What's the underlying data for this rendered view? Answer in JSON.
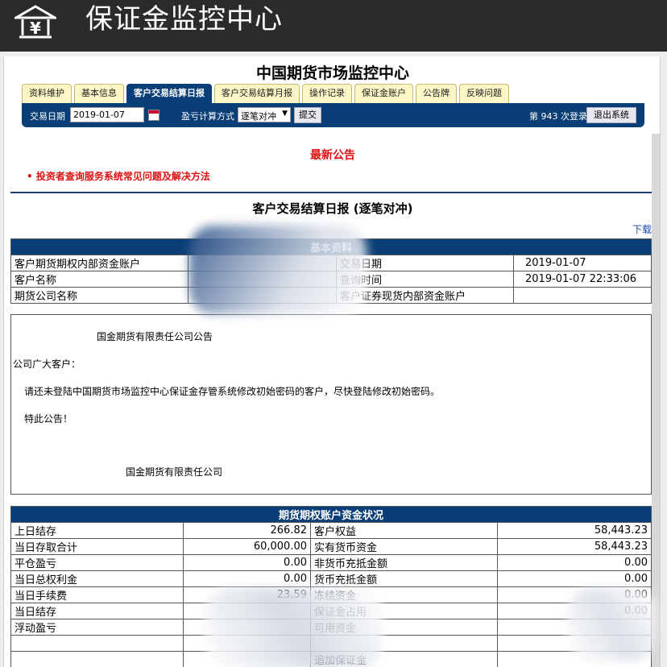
{
  "app": {
    "title": "保证金监控中心",
    "logo_icon": "bank-yen-icon"
  },
  "page": {
    "heading": "中国期货市场监控中心",
    "tabs": [
      "资料维护",
      "基本信息",
      "客户交易结算日报",
      "客户交易结算月报",
      "操作记录",
      "保证金账户",
      "公告牌",
      "反映问题"
    ],
    "active_tab": "客户交易结算日报"
  },
  "toolbar": {
    "date_label": "交易日期",
    "date_value": "2019-01-07",
    "calc_label": "盈亏计算方式",
    "calc_value": "逐笔对冲",
    "submit_label": "提交",
    "login_count": "第 943 次登录",
    "logout_label": "退出系统"
  },
  "notice": {
    "title": "最新公告",
    "item": "• 投资者查询服务系统常见问题及解决方法"
  },
  "report": {
    "title": "客户交易结算日报 (逐笔对冲)",
    "download": "下载"
  },
  "basic_info": {
    "header": "基本资料",
    "rows": [
      [
        "客户期货期权内部资金账户",
        "",
        "交易日期",
        "2019-01-07"
      ],
      [
        "客户名称",
        "",
        "查询时间",
        "2019-01-07 22:33:06"
      ],
      [
        "期货公司名称",
        "",
        "客户证券现货内部资金账户",
        ""
      ]
    ]
  },
  "announcement": {
    "heading": "国金期货有限责任公司公告",
    "salutation": "公司广大客户：",
    "body": "请还未登陆中国期货市场监控中心保证金存管系统修改初始密码的客户，尽快登陆修改初始密码。",
    "closing": "特此公告！",
    "signature": "国金期货有限责任公司"
  },
  "fund_status": {
    "header": "期货期权账户资金状况",
    "rows": [
      [
        "上日结存",
        "266.82",
        "客户权益",
        "58,443.23"
      ],
      [
        "当日存取合计",
        "60,000.00",
        "实有货币资金",
        "58,443.23"
      ],
      [
        "平仓盈亏",
        "0.00",
        "非货币充抵金额",
        "0.00"
      ],
      [
        "当日总权利金",
        "0.00",
        "货币充抵金额",
        "0.00"
      ],
      [
        "当日手续费",
        "23.59",
        "冻结资金",
        "0.00"
      ],
      [
        "当日结存",
        "",
        "保证金占用",
        "0.00"
      ],
      [
        "浮动盈亏",
        "",
        "可用资金",
        ""
      ],
      [
        "",
        "",
        "",
        ""
      ],
      [
        "",
        "",
        "追加保证金",
        ""
      ]
    ]
  },
  "colors": {
    "navy": "#0a3e76",
    "notice_red": "#d11",
    "tab_yellow": "#fdf6c6"
  }
}
